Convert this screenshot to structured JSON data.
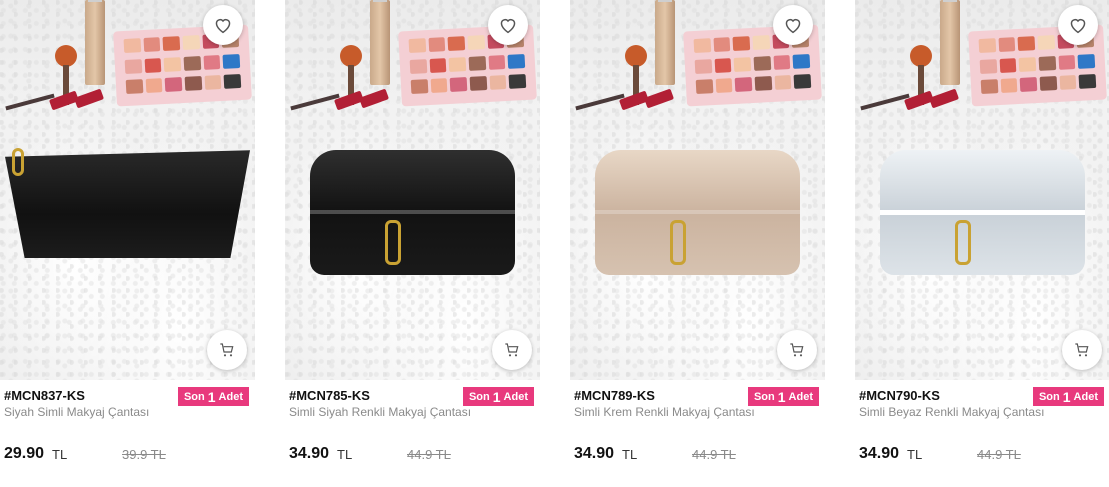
{
  "icons": {
    "favorite": "heart-outline-icon",
    "cart": "shopping-cart-icon"
  },
  "colors": {
    "badge_bg": "#e8397d",
    "badge_text": "#ffffff",
    "product_code": "#111111",
    "product_name": "#8a8a8a",
    "price": "#111111",
    "old_price": "#8a8a8a"
  },
  "products": [
    {
      "code": "#MCN837-KS",
      "badge": {
        "prefix": "Son",
        "count": "1",
        "unit": "Adet"
      },
      "name": "Siyah Simli Makyaj Çantası",
      "price": "29.90",
      "currency": "TL",
      "old_price": "39.9 TL",
      "image_alt": "black glittery cosmetic pouch"
    },
    {
      "code": "#MCN785-KS",
      "badge": {
        "prefix": "Son",
        "count": "1",
        "unit": "Adet"
      },
      "name": "Simli Siyah Renkli Makyaj Çantası",
      "price": "34.90",
      "currency": "TL",
      "old_price": "44.9 TL",
      "image_alt": "black glittery makeup case"
    },
    {
      "code": "#MCN789-KS",
      "badge": {
        "prefix": "Son",
        "count": "1",
        "unit": "Adet"
      },
      "name": "Simli Krem Renkli Makyaj Çantası",
      "price": "34.90",
      "currency": "TL",
      "old_price": "44.9 TL",
      "image_alt": "cream glittery makeup case"
    },
    {
      "code": "#MCN790-KS",
      "badge": {
        "prefix": "Son",
        "count": "1",
        "unit": "Adet"
      },
      "name": "Simli Beyaz Renkli Makyaj Çantası",
      "price": "34.90",
      "currency": "TL",
      "old_price": "44.9 TL",
      "image_alt": "white silver glittery makeup case"
    }
  ]
}
